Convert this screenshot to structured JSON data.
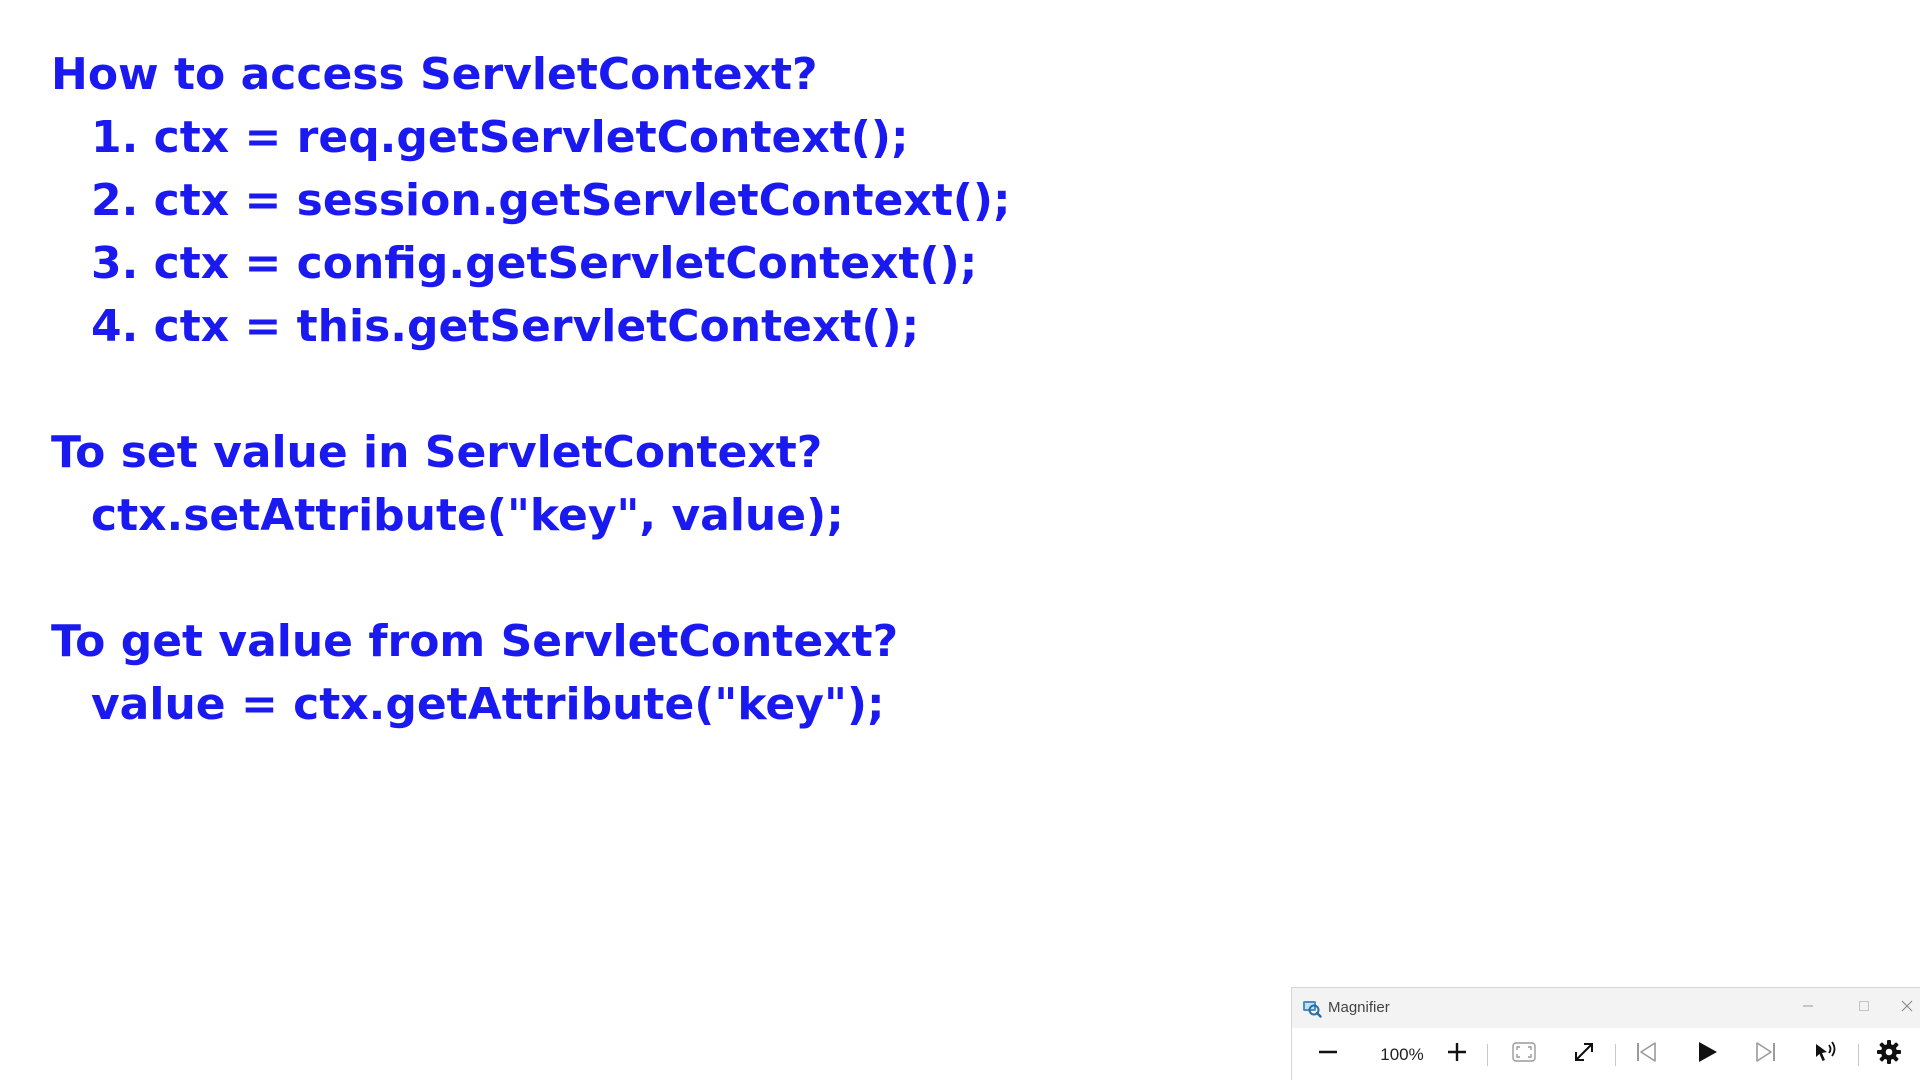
{
  "slide": {
    "text_color": "#1a1af0",
    "lines": [
      "How to access ServletContext?",
      "1. ctx = req.getServletContext();",
      "2. ctx = session.getServletContext();",
      "3. ctx = config.getServletContext();",
      "4. ctx = this.getServletContext();",
      "To set value in ServletContext?",
      "ctx.setAttribute(\"key\", value);",
      "To get value from ServletContext?",
      "value = ctx.getAttribute(\"key\");"
    ]
  },
  "magnifier": {
    "title": "Magnifier",
    "zoom_level": "100%",
    "icons": {
      "app": "magnifier-app-icon",
      "minimize": "minimize-icon",
      "maximize": "maximize-icon",
      "close": "close-icon",
      "zoom_out": "minus-icon",
      "zoom_in": "plus-icon",
      "fit": "fit-screen-icon",
      "expand": "expand-icon",
      "previous": "skip-previous-icon",
      "play": "play-icon",
      "next": "skip-next-icon",
      "read_from_here": "read-from-here-icon",
      "settings": "gear-icon"
    }
  }
}
